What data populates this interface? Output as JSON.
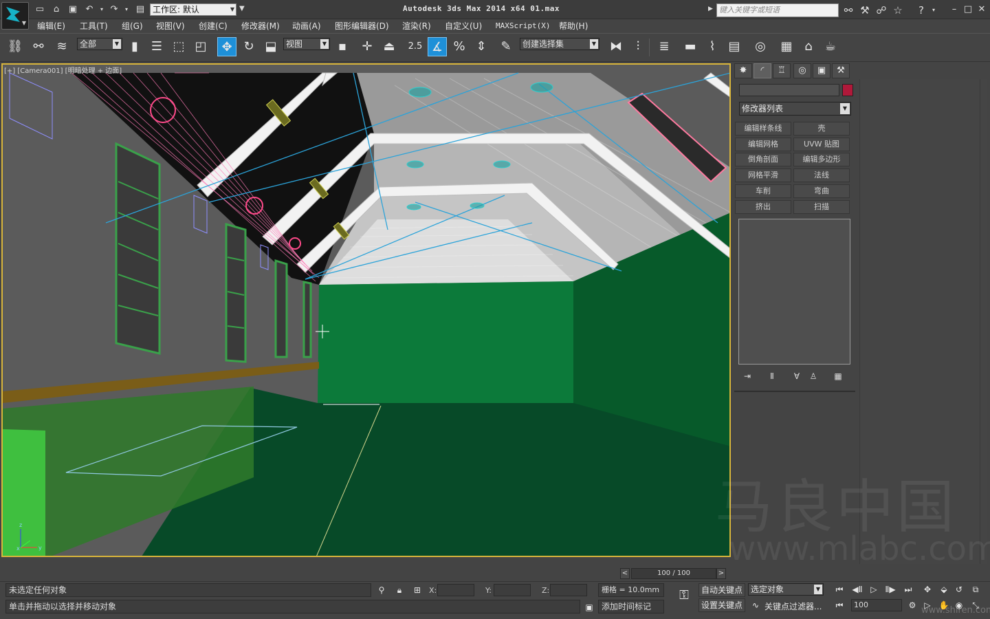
{
  "title_bar": {
    "app_title": "Autodesk 3ds Max  2014 x64     01.max",
    "workspace_label": "工作区: 默认",
    "search_placeholder": "键入关键字或短语",
    "icons": [
      "new-icon",
      "open-icon",
      "save-icon",
      "undo-icon",
      "redo-icon",
      "project-icon",
      "binoculars-icon",
      "tools-icon",
      "user-icon",
      "star-icon",
      "help-icon"
    ],
    "window_buttons": [
      "minimize",
      "maximize",
      "close"
    ]
  },
  "menu": {
    "items": [
      "编辑(E)",
      "工具(T)",
      "组(G)",
      "视图(V)",
      "创建(C)",
      "修改器(M)",
      "动画(A)",
      "图形编辑器(D)",
      "渲染(R)",
      "自定义(U)",
      "MAXScript(X)",
      "帮助(H)"
    ]
  },
  "toolbar": {
    "selection_filter": "全部",
    "reference_coord": "视图",
    "snap_value": "2.5",
    "named_selection": "创建选择集",
    "active_tool": "select-and-move"
  },
  "viewport": {
    "label": "[+] [Camera001] [明暗处理 + 边面]",
    "axis_x": "x",
    "axis_y": "y",
    "axis_z": "z",
    "colors": {
      "wall": "#595959",
      "green_wall": "#0c7a3a",
      "floor": "#074a28",
      "ceiling": "#c9c9c9",
      "selected_edge": "#d8b53b"
    }
  },
  "command_panel": {
    "tabs": [
      "create",
      "modify",
      "hierarchy",
      "motion",
      "display",
      "utilities"
    ],
    "object_color": "#b0193a",
    "modifier_list": "修改器列表",
    "buttons": [
      "编辑样条线",
      "壳",
      "编辑网格",
      "UVW 贴图",
      "倒角剖面",
      "编辑多边形",
      "网格平滑",
      "法线",
      "车削",
      "弯曲",
      "挤出",
      "扫描"
    ]
  },
  "time_slider": {
    "frame": "100 / 100"
  },
  "status": {
    "selection_text": "未选定任何对象",
    "prompt_text": "单击并拖动以选择并移动对象",
    "x_label": "X:",
    "y_label": "Y:",
    "z_label": "Z:",
    "grid": "栅格 = 10.0mm",
    "add_time_tag": "添加时间标记",
    "auto_key": "自动关键点",
    "set_key": "设置关键点",
    "key_mode": "选定对象",
    "key_filters": "关键点过滤器...",
    "current_frame": "100"
  },
  "watermark": {
    "line1": "马良中国",
    "line2": "www.mlabc.com",
    "site": "www.shiren.com"
  }
}
